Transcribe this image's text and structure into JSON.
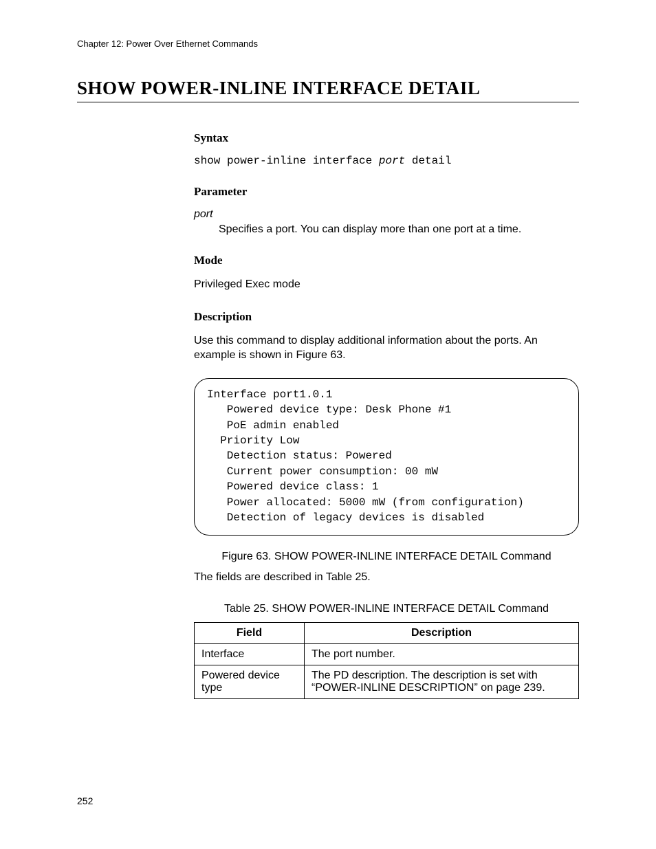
{
  "chapter": "Chapter 12: Power Over Ethernet Commands",
  "title": "SHOW POWER-INLINE INTERFACE DETAIL",
  "syntax": {
    "heading": "Syntax",
    "command_prefix": "show power-inline interface ",
    "command_param": "port",
    "command_suffix": " detail"
  },
  "parameter": {
    "heading": "Parameter",
    "name": "port",
    "desc": "Specifies a port. You can display more than one port at a time."
  },
  "mode": {
    "heading": "Mode",
    "text": "Privileged Exec mode"
  },
  "description": {
    "heading": "Description",
    "text": "Use this command to display additional information about the ports. An example is shown in Figure 63."
  },
  "code_block": "Interface port1.0.1\n   Powered device type: Desk Phone #1\n   PoE admin enabled\n  Priority Low\n   Detection status: Powered\n   Current power consumption: 00 mW\n   Powered device class: 1\n   Power allocated: 5000 mW (from configuration)\n   Detection of legacy devices is disabled",
  "figure_caption": "Figure 63. SHOW POWER-INLINE INTERFACE DETAIL Command",
  "table_intro": "The fields are described in Table 25.",
  "table_caption": "Table 25. SHOW POWER-INLINE INTERFACE DETAIL Command",
  "table": {
    "headers": {
      "field": "Field",
      "desc": "Description"
    },
    "rows": [
      {
        "field": "Interface",
        "desc": "The port number."
      },
      {
        "field": "Powered device type",
        "desc": "The PD description. The description is set with “POWER-INLINE DESCRIPTION” on page 239."
      }
    ]
  },
  "page_number": "252"
}
